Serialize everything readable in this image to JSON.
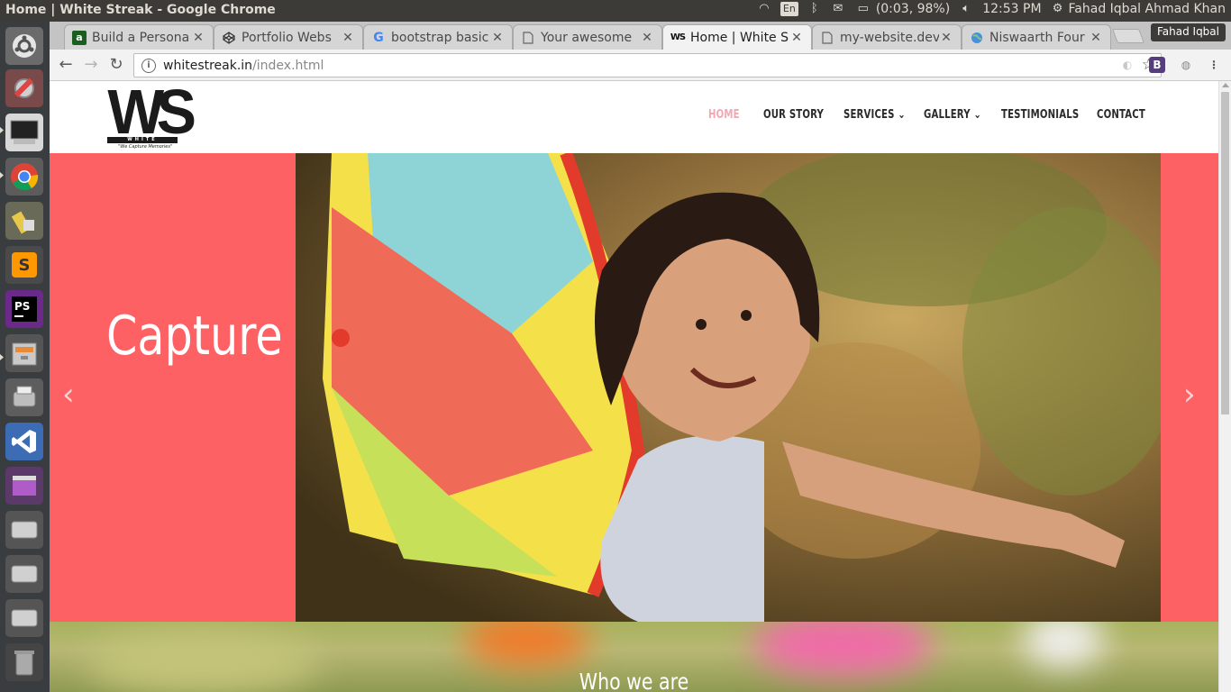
{
  "top_panel": {
    "window_title": "Home | White Streak - Google Chrome",
    "keyboard": "En",
    "battery": "(0:03, 98%)",
    "clock": "12:53 PM",
    "user": "Fahad Iqbal Ahmad Khan"
  },
  "launcher": {
    "items": [
      "ubuntu-dash",
      "system-settings",
      "terminal",
      "chrome",
      "bleachbit",
      "sublime-text",
      "phpstorm",
      "file-manager",
      "printer-settings",
      "visual-studio-code",
      "app-window",
      "drive-1",
      "drive-2",
      "drive-3",
      "trash"
    ]
  },
  "browser": {
    "profile": "Fahad Iqbal",
    "tabs": [
      {
        "title": "Build a Persona",
        "icon": "upwork-icon"
      },
      {
        "title": "Portfolio Webs",
        "icon": "codepen-icon"
      },
      {
        "title": "bootstrap basic",
        "icon": "google-icon"
      },
      {
        "title": "Your awesome",
        "icon": "document-icon"
      },
      {
        "title": "Home | White S",
        "icon": "ws-icon",
        "active": true
      },
      {
        "title": "my-website.dev",
        "icon": "document-icon"
      },
      {
        "title": "Niswaarth Four",
        "icon": "globe-icon"
      }
    ],
    "url_host": "whitestreak.in",
    "url_path": "/index.html"
  },
  "site": {
    "logo_text": "WS",
    "logo_band": "WHITE STREAK",
    "logo_tagline": "\"We Capture Memories\"",
    "nav": [
      {
        "label": "HOME",
        "active": true
      },
      {
        "label": "OUR STORY"
      },
      {
        "label": "SERVICES"
      },
      {
        "label": "GALLERY"
      },
      {
        "label": "TESTIMONIALS"
      },
      {
        "label": "CONTACT"
      }
    ],
    "hero_text": "Capture",
    "about_title": "Who we are",
    "colors": {
      "hero_bg": "#fd6163",
      "nav_active": "#f4a7b1"
    }
  }
}
